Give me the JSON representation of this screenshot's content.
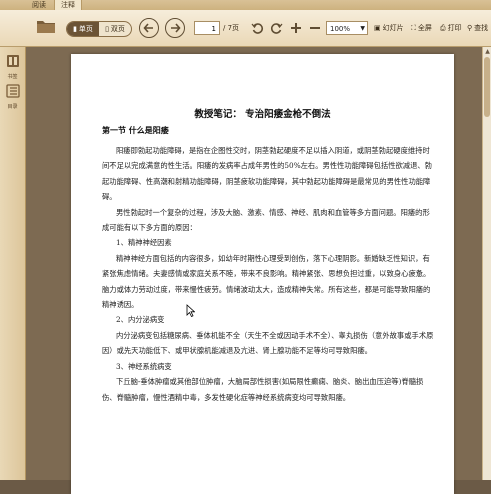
{
  "tabs": [
    {
      "label": "阅读"
    },
    {
      "label": "注释"
    }
  ],
  "toolbar": {
    "single_page": "单页",
    "double_page": "双页",
    "page_current": "1",
    "page_total": "/ 7页",
    "zoom": "100%",
    "slideshow": "幻灯片",
    "fullscreen": "全屏",
    "print": "打印",
    "find": "查找"
  },
  "sidebar": {
    "items": [
      {
        "label": "书签"
      },
      {
        "label": "目录"
      }
    ]
  },
  "document": {
    "title": "教授笔记： 专治阳痿金枪不倒法",
    "section_title": "第一节 什么是阳痿",
    "paragraphs": [
      "阳痿即勃起功能障碍，是指在企图性交时，阴茎勃起硬度不足以插入阴道，或阴茎勃起硬度维持时间不足以完成满意的性生活。阳痿的发病率占成年男性的50%左右。男性性功能障碍包括性欲减退、勃起功能障碍、性高潮和射精功能障碍，阴茎疲软功能障碍，其中勃起功能障碍是最常见的男性性功能障碍。",
      "男性勃起时一个复杂的过程，涉及大脑、激素、情感、神经、肌肉和血管等多方面问题。阳痿的形成可能有以下多方面的原因：",
      "1、精神神经因素",
      "精神神经方面包括的内容很多，如幼年时期性心理受到创伤，落下心理阴影。新婚缺乏性知识，有紧张焦虑情绪。夫妻感情或家庭关系不睦，带来不良影响。精神紧张、思想负担过重，以致身心疲惫。脑力或体力劳动过度，带来慢性疲劳。情绪波动太大，造成精神失常。所有这些，都是可能导致阳痿的精神诱因。",
      "2、内分泌病变",
      "内分泌病变包括糖尿病、垂体机能不全（天生不全或因动手术不全）、睾丸损伤（意外故事或手术原因）或先天功能低下、或甲状腺机能减退及亢进、肾上腺功能不足等均可导致阳痿。",
      "3、神经系统病变",
      "下丘脑-垂体肿瘤或其他部位肿瘤，大脑局部性损害(如局限性癫痫、脑炎、脑出血压迫等)脊髓损伤、脊髓肿瘤，慢性酒精中毒，多发性硬化症等神经系统病变均可导致阳痿。"
    ]
  }
}
